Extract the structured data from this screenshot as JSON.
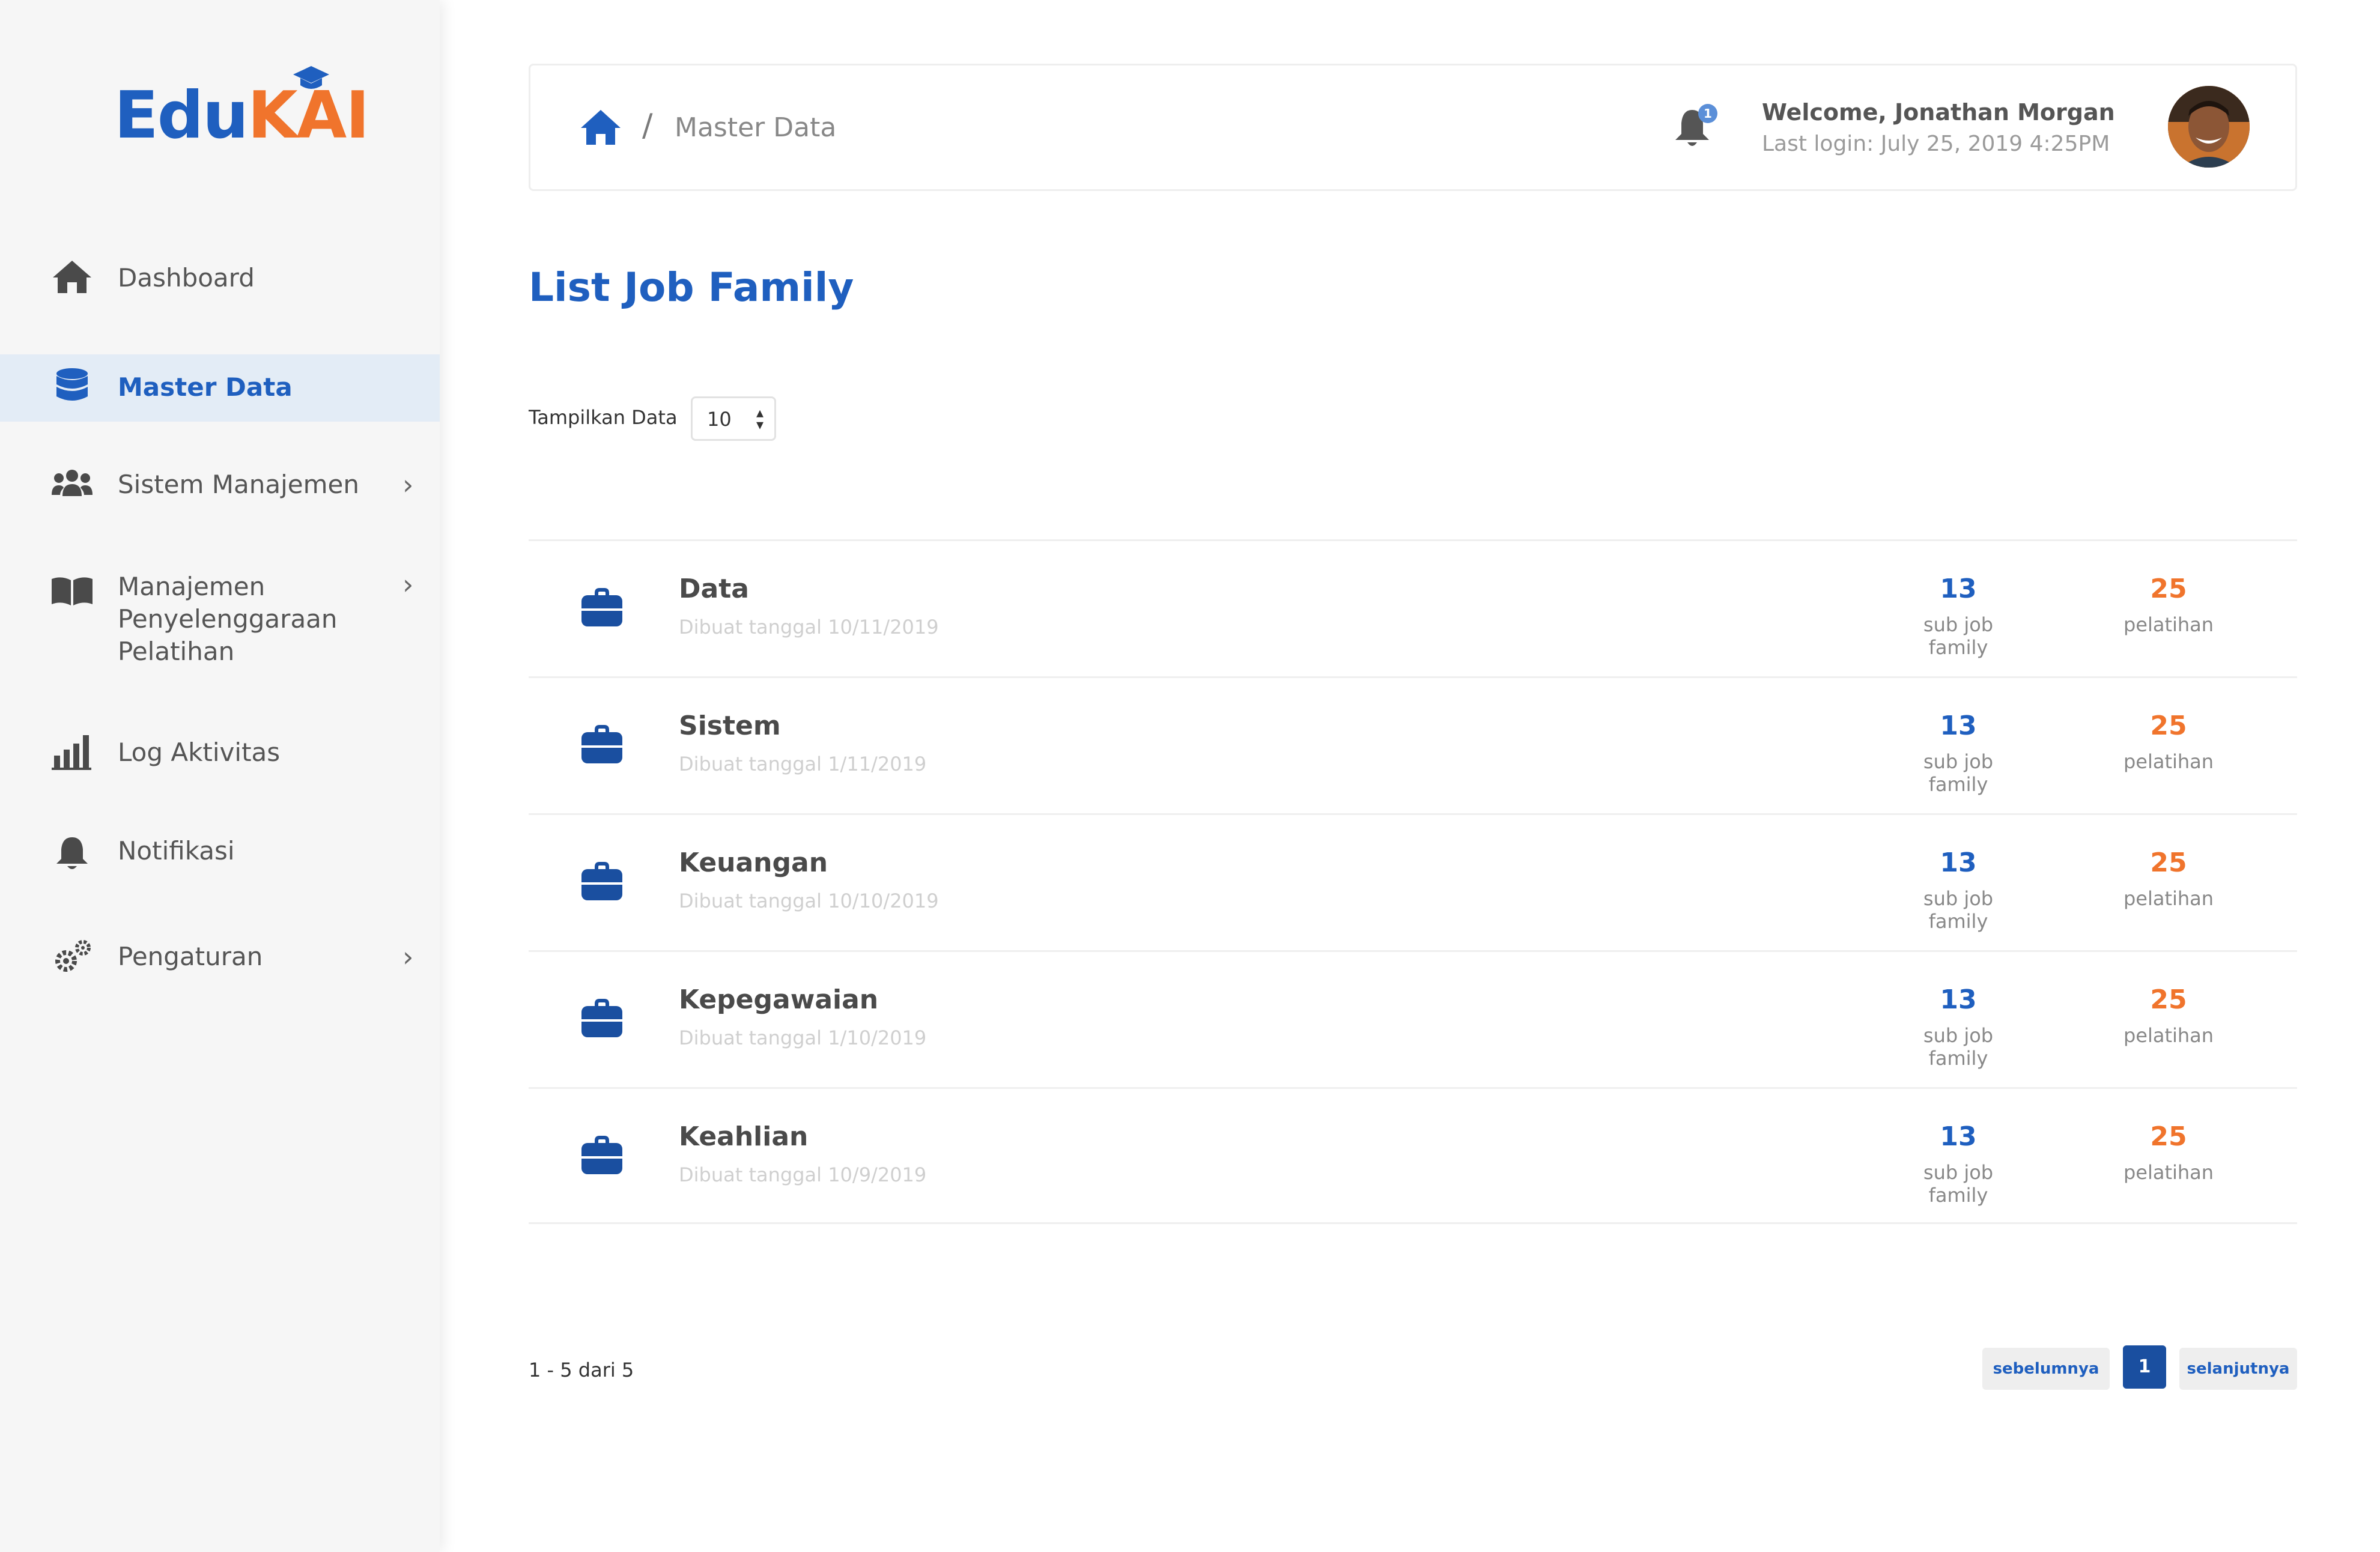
{
  "brand": {
    "part1": "Edu",
    "part2": "KAI",
    "primary_color": "#1f5fbf",
    "accent_color": "#f0742c"
  },
  "sidebar": {
    "items": [
      {
        "label": "Dashboard",
        "icon": "home-icon",
        "active": false,
        "has_submenu": false
      },
      {
        "label": "Master Data",
        "icon": "database-icon",
        "active": true,
        "has_submenu": false
      },
      {
        "label": "Sistem Manajemen",
        "icon": "users-icon",
        "active": false,
        "has_submenu": true
      },
      {
        "label_lines": [
          "Manajemen",
          "Penyelenggaraan",
          "Pelatihan"
        ],
        "icon": "book-icon",
        "active": false,
        "has_submenu": true
      },
      {
        "label": "Log Aktivitas",
        "icon": "bar-chart-icon",
        "active": false,
        "has_submenu": false
      },
      {
        "label": "Notifikasi",
        "icon": "bell-icon",
        "active": false,
        "has_submenu": false
      },
      {
        "label": "Pengaturan",
        "icon": "gears-icon",
        "active": false,
        "has_submenu": true
      }
    ],
    "arrow": "›"
  },
  "header": {
    "breadcrumb_separator": "/",
    "breadcrumb_current": "Master Data",
    "notification_count": "1",
    "welcome": "Welcome, Jonathan Morgan",
    "last_login": "Last login: July 25, 2019 4:25PM"
  },
  "main": {
    "title": "List Job Family",
    "show_label": "Tampilkan Data",
    "show_value": "10",
    "rows": [
      {
        "name": "Data",
        "date": "Dibuat tanggal 10/11/2019",
        "sub_count": "13",
        "sub_label": "sub job family",
        "training_count": "25",
        "training_label": "pelatihan"
      },
      {
        "name": "Sistem",
        "date": "Dibuat tanggal 1/11/2019",
        "sub_count": "13",
        "sub_label": "sub job family",
        "training_count": "25",
        "training_label": "pelatihan"
      },
      {
        "name": "Keuangan",
        "date": "Dibuat tanggal 10/10/2019",
        "sub_count": "13",
        "sub_label": "sub job family",
        "training_count": "25",
        "training_label": "pelatihan"
      },
      {
        "name": "Kepegawaian",
        "date": "Dibuat tanggal 1/10/2019",
        "sub_count": "13",
        "sub_label": "sub job family",
        "training_count": "25",
        "training_label": "pelatihan"
      },
      {
        "name": "Keahlian",
        "date": "Dibuat tanggal 10/9/2019",
        "sub_count": "13",
        "sub_label": "sub job family",
        "training_count": "25",
        "training_label": "pelatihan"
      }
    ],
    "range_text": "1 - 5 dari 5",
    "pagination": {
      "prev": "sebelumnya",
      "current": "1",
      "next": "selanjutnya"
    }
  }
}
